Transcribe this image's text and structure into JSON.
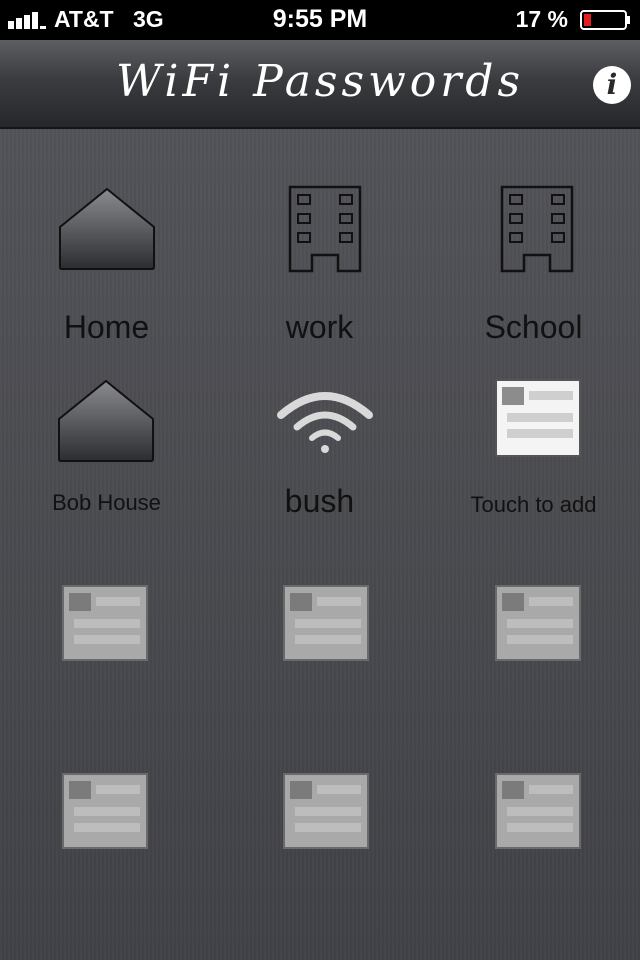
{
  "status_bar": {
    "carrier": "AT&T",
    "network": "3G",
    "time": "9:55 PM",
    "battery_percent": "17 %"
  },
  "navbar": {
    "title": "WiFi Passwords",
    "info_icon": "info-icon"
  },
  "grid": [
    {
      "label": "Home",
      "icon": "house-icon"
    },
    {
      "label": "work",
      "icon": "building-icon"
    },
    {
      "label": "School",
      "icon": "building-icon"
    },
    {
      "label": "Bob House",
      "icon": "house-icon"
    },
    {
      "label": "bush",
      "icon": "wifi-icon"
    },
    {
      "label": "Touch to add",
      "icon": "add-card-icon"
    },
    {
      "label": "",
      "icon": "empty-card-icon"
    },
    {
      "label": "",
      "icon": "empty-card-icon"
    },
    {
      "label": "",
      "icon": "empty-card-icon"
    },
    {
      "label": "",
      "icon": "empty-card-icon"
    },
    {
      "label": "",
      "icon": "empty-card-icon"
    },
    {
      "label": "",
      "icon": "empty-card-icon"
    }
  ],
  "colors": {
    "background": "#4a4b50",
    "label": "#111111",
    "empty_card": "#a9a9a9",
    "active_card": "#f4f4f4"
  }
}
